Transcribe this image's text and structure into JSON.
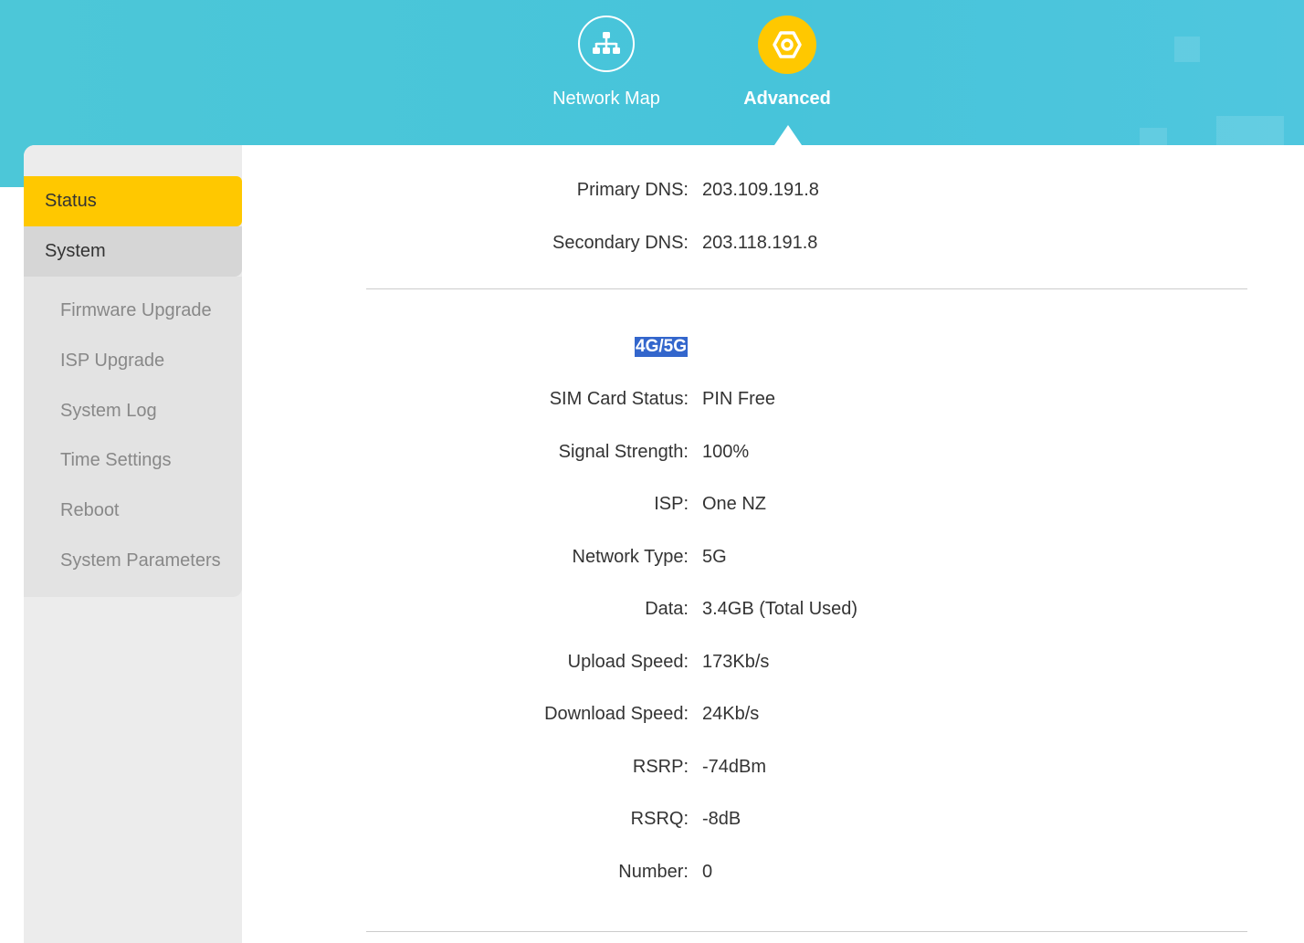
{
  "nav": {
    "network_map": "Network Map",
    "advanced": "Advanced"
  },
  "sidebar": {
    "status": "Status",
    "system": "System",
    "items": [
      "Firmware Upgrade",
      "ISP Upgrade",
      "System Log",
      "Time Settings",
      "Reboot",
      "System Parameters"
    ]
  },
  "dns": {
    "primary_label": "Primary DNS:",
    "primary_value": "203.109.191.8",
    "secondary_label": "Secondary DNS:",
    "secondary_value": "203.118.191.8"
  },
  "cellular": {
    "title": "4G/5G",
    "rows": [
      {
        "label": "SIM Card Status:",
        "value": "PIN Free"
      },
      {
        "label": "Signal Strength:",
        "value": "100%"
      },
      {
        "label": "ISP:",
        "value": "One NZ"
      },
      {
        "label": "Network Type:",
        "value": "5G"
      },
      {
        "label": "Data:",
        "value": "3.4GB (Total Used)"
      },
      {
        "label": "Upload Speed:",
        "value": "173Kb/s"
      },
      {
        "label": "Download Speed:",
        "value": "24Kb/s"
      },
      {
        "label": "RSRP:",
        "value": "-74dBm"
      },
      {
        "label": "RSRQ:",
        "value": "-8dB"
      },
      {
        "label": "Number:",
        "value": "0"
      }
    ]
  },
  "colors": {
    "header": "#4cc7d8",
    "accent": "#ffc800",
    "highlight": "#3366cc"
  },
  "icons": {
    "network_map": "network-topology-icon",
    "advanced": "gear-icon"
  }
}
